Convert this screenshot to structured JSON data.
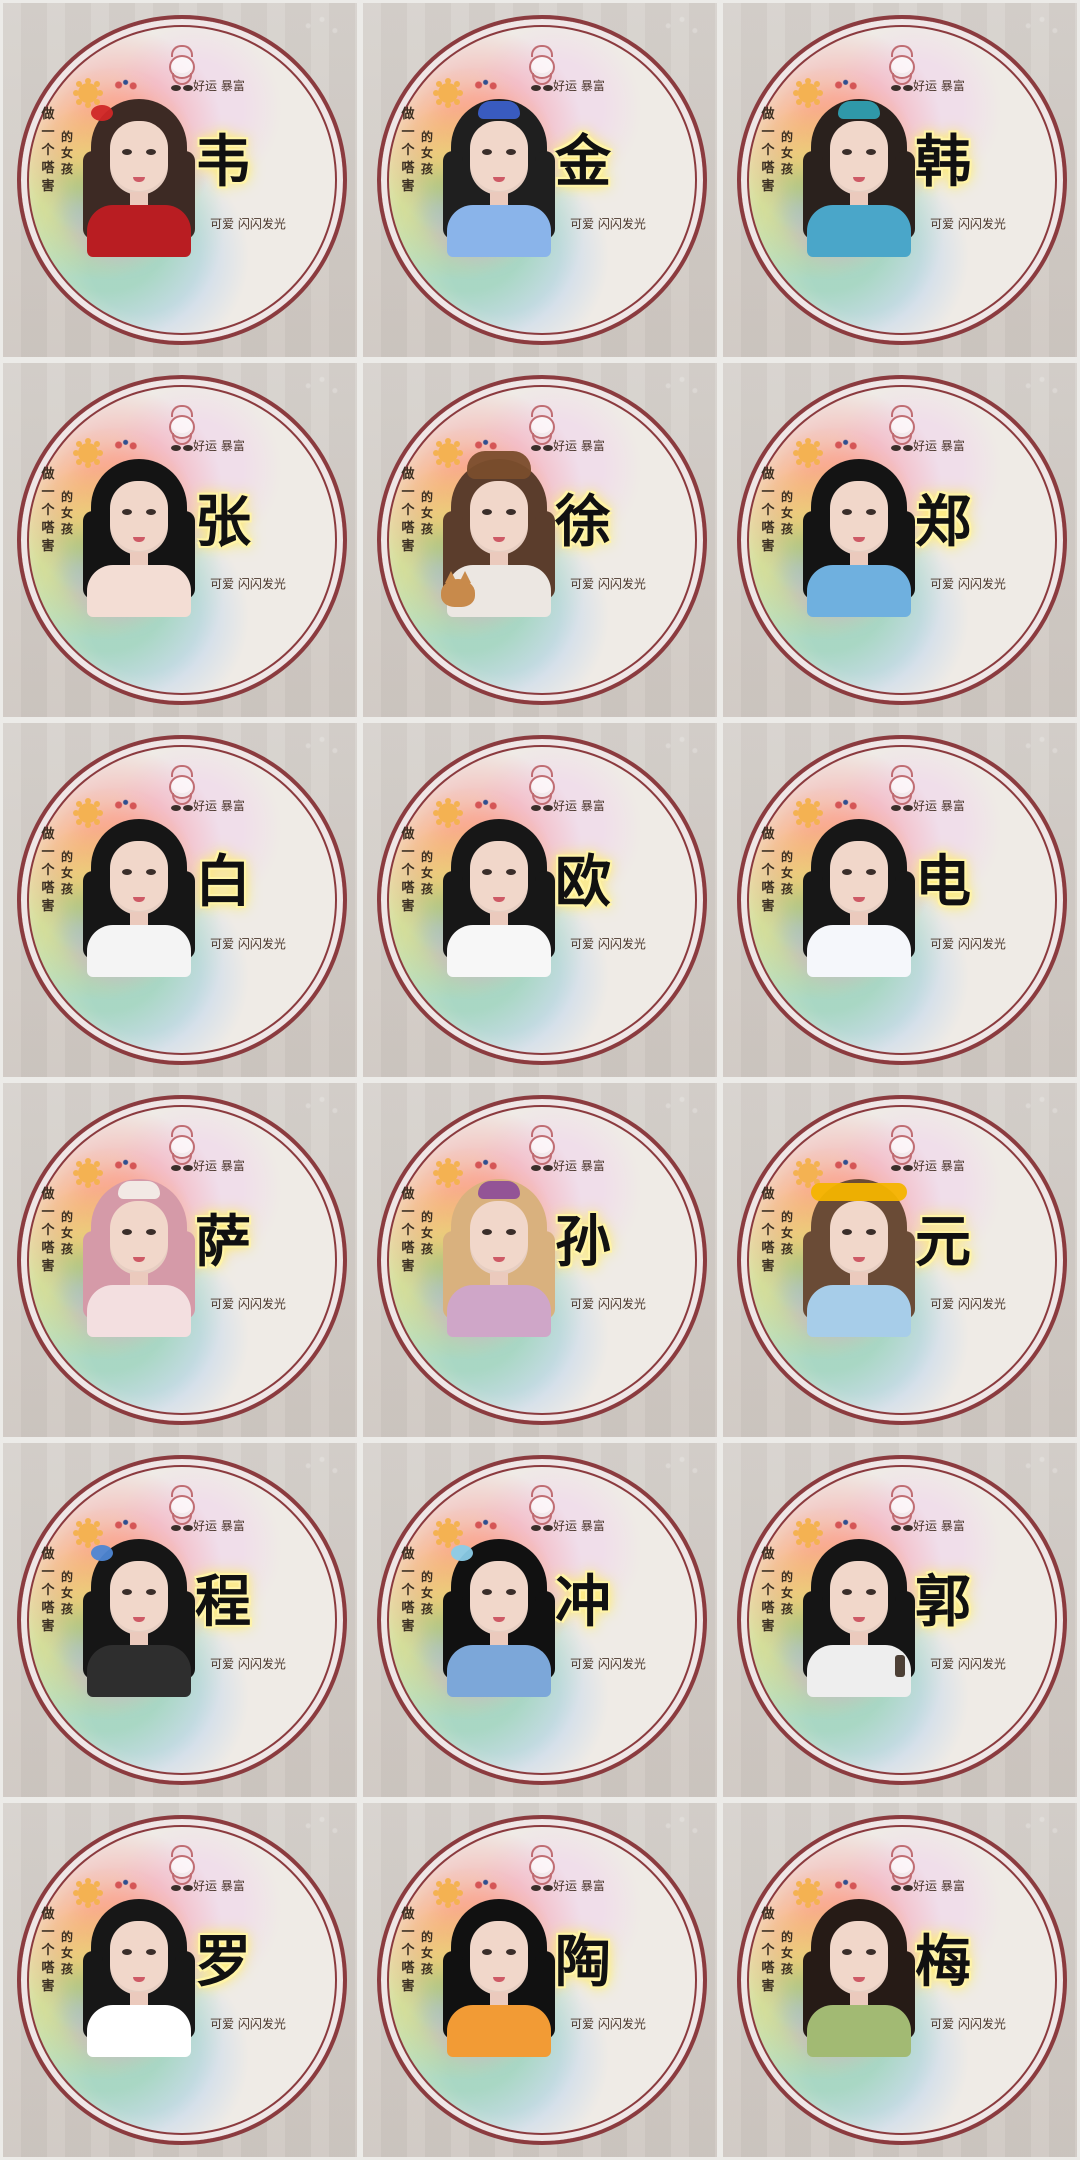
{
  "common": {
    "slogan_left": "做一个嗒害",
    "slogan_mid": "的女孩",
    "tag_top": "好运 暴富",
    "tag_bottom": "可爱 闪闪发光"
  },
  "tiles": [
    {
      "surname": "韦",
      "hair": "#3d2a24",
      "clothes": "#b91d22",
      "accent": "#d02727",
      "accent_type": "bow"
    },
    {
      "surname": "金",
      "hair": "#1f1f1f",
      "clothes": "#8ab4ea",
      "accent": "#3b5fc8",
      "accent_type": "hat"
    },
    {
      "surname": "韩",
      "hair": "#2a211d",
      "clothes": "#4aa6c9",
      "accent": "#2f9fb1",
      "accent_type": "hat"
    },
    {
      "surname": "张",
      "hair": "#141414",
      "clothes": "#f3ddd4",
      "accent": "#4f76b8",
      "accent_type": "none"
    },
    {
      "surname": "徐",
      "hair": "#5b3d2c",
      "clothes": "#ece7e2",
      "accent": "#7a4d2c",
      "accent_type": "ears"
    },
    {
      "surname": "郑",
      "hair": "#141414",
      "clothes": "#6fb0df",
      "accent": "#70b1e2",
      "accent_type": "none"
    },
    {
      "surname": "白",
      "hair": "#161616",
      "clothes": "#f4f4f4",
      "accent": "#2f2f2f",
      "accent_type": "none"
    },
    {
      "surname": "欧",
      "hair": "#171717",
      "clothes": "#f7f7f7",
      "accent": "#c52b2b",
      "accent_type": "none"
    },
    {
      "surname": "电",
      "hair": "#171717",
      "clothes": "#f5f7fb",
      "accent": "#dfe5f1",
      "accent_type": "none"
    },
    {
      "surname": "萨",
      "hair": "#d59aa8",
      "clothes": "#f3dfe0",
      "accent": "#f3ede8",
      "accent_type": "hat"
    },
    {
      "surname": "孙",
      "hair": "#d9b17e",
      "clothes": "#cfa6c8",
      "accent": "#8f4f98",
      "accent_type": "hat"
    },
    {
      "surname": "元",
      "hair": "#6a4b36",
      "clothes": "#a7cde9",
      "accent": "#f4b400",
      "accent_type": "flowers"
    },
    {
      "surname": "程",
      "hair": "#161616",
      "clothes": "#2e2e2e",
      "accent": "#4d86d4",
      "accent_type": "bow"
    },
    {
      "surname": "冲",
      "hair": "#111111",
      "clothes": "#7ca7d9",
      "accent": "#8acce8",
      "accent_type": "bow"
    },
    {
      "surname": "郭",
      "hair": "#151515",
      "clothes": "#eeeeee",
      "accent": "#403733",
      "accent_type": "phone"
    },
    {
      "surname": "罗",
      "hair": "#171717",
      "clothes": "#ffffff",
      "accent": "#ffffff",
      "accent_type": "none"
    },
    {
      "surname": "陶",
      "hair": "#111111",
      "clothes": "#f29b35",
      "accent": "#e97d26",
      "accent_type": "none"
    },
    {
      "surname": "梅",
      "hair": "#261b16",
      "clothes": "#a2ba73",
      "accent": "#9dbd6a",
      "accent_type": "none"
    }
  ]
}
